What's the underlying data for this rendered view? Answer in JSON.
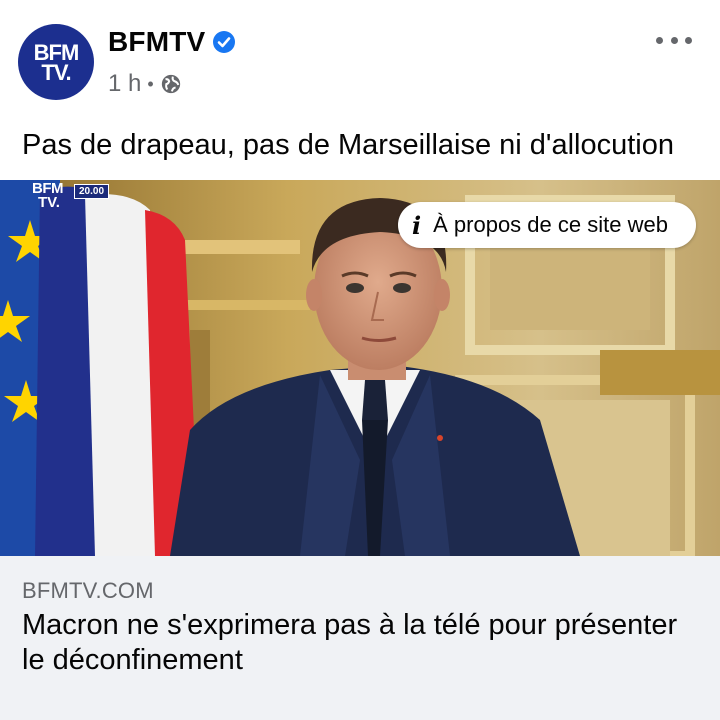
{
  "header": {
    "avatar_line1": "BFM",
    "avatar_line2": "TV.",
    "page_name": "BFMTV",
    "time_ago": "1 h",
    "separator": "•",
    "verified_icon": "verified-badge-icon",
    "audience_icon": "globe-icon",
    "more_icon": "more-options-icon"
  },
  "post": {
    "text": "Pas de drapeau, pas de Marseillaise ni d'allocution"
  },
  "image": {
    "bug_line1": "BFM",
    "bug_line2": "TV.",
    "bug_time": "20.00",
    "about_label": "À propos de ce site web",
    "about_icon": "info-icon"
  },
  "link": {
    "domain": "BFMTV.COM",
    "title": "Macron ne s'exprimera pas à la télé pour présenter le déconfinement"
  },
  "colors": {
    "brand": "#1c2f8f",
    "verified": "#1877f2",
    "footer_bg": "#f0f2f5",
    "secondary_text": "#65676b"
  }
}
